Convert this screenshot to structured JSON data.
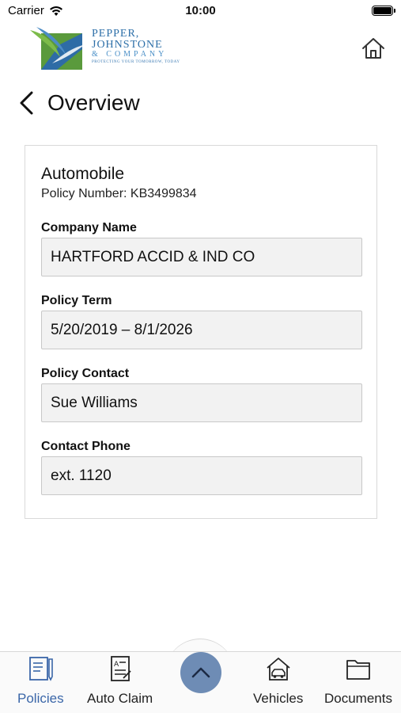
{
  "status_bar": {
    "carrier": "Carrier",
    "time": "10:00"
  },
  "logo": {
    "line1": "PEPPER,",
    "line2": "JOHNSTONE",
    "line3": "& COMPANY",
    "tagline": "PROTECTING YOUR TOMORROW, TODAY"
  },
  "header": {
    "title": "Overview",
    "home_icon": "home-icon",
    "back_icon": "chevron-left-icon"
  },
  "policy": {
    "type": "Automobile",
    "number_text": "Policy Number: KB3499834",
    "fields": [
      {
        "label": "Company Name",
        "value": "HARTFORD ACCID & IND CO"
      },
      {
        "label": "Policy Term",
        "value": "5/20/2019 – 8/1/2026"
      },
      {
        "label": "Policy Contact",
        "value": "Sue Williams"
      },
      {
        "label": "Contact Phone",
        "value": "ext. 1120"
      }
    ]
  },
  "tab_bar": {
    "tabs": [
      {
        "label": "Policies",
        "icon": "policies-icon",
        "active": true
      },
      {
        "label": "Auto Claim",
        "icon": "auto-claim-icon",
        "active": false
      },
      {
        "label": "Vehicles",
        "icon": "vehicles-icon",
        "active": false
      },
      {
        "label": "Documents",
        "icon": "documents-icon",
        "active": false
      }
    ],
    "center_icon": "chevron-up-icon"
  },
  "colors": {
    "accent": "#3a66a8",
    "center_button": "#6e8cb5",
    "field_bg": "#f2f2f2"
  }
}
